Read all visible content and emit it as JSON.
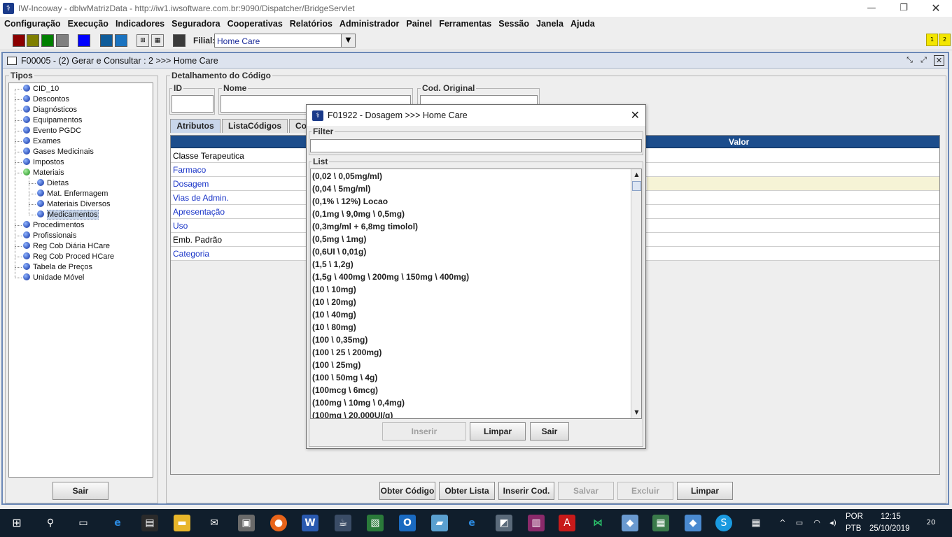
{
  "window": {
    "title": "IW-Incoway - dblwMatrizData - http://iw1.iwsoftware.com.br:9090/Dispatcher/BridgeServlet"
  },
  "menu": [
    "Configuração",
    "Execução",
    "Indicadores",
    "Seguradora",
    "Cooperativas",
    "Relatórios",
    "Administrador",
    "Painel",
    "Ferramentas",
    "Sessão",
    "Janela",
    "Ajuda"
  ],
  "toolbar": {
    "filial_label": "Filial:",
    "filial_value": "Home Care",
    "badges": [
      "1",
      "2"
    ],
    "swatch_colors": [
      "#8b0000",
      "#7f7f00",
      "#007f00",
      "#7f7f7f",
      "#0000ff",
      "#0f5c9a",
      "#1a73c0",
      "#3a3a3a"
    ]
  },
  "frame": {
    "title": "F00005 - (2) Gerar e Consultar : 2 >>> Home Care"
  },
  "tipos": {
    "label": "Tipos",
    "items": [
      {
        "label": "CID_10",
        "level": 0
      },
      {
        "label": "Descontos",
        "level": 0
      },
      {
        "label": "Diagnósticos",
        "level": 0
      },
      {
        "label": "Equipamentos",
        "level": 0
      },
      {
        "label": "Evento PGDC",
        "level": 0
      },
      {
        "label": "Exames",
        "level": 0
      },
      {
        "label": "Gases Medicinais",
        "level": 0
      },
      {
        "label": "Impostos",
        "level": 0
      },
      {
        "label": "Materiais",
        "level": 0,
        "expanded": true
      },
      {
        "label": "Dietas",
        "level": 1
      },
      {
        "label": "Mat. Enfermagem",
        "level": 1
      },
      {
        "label": "Materiais Diversos",
        "level": 1
      },
      {
        "label": "Medicamentos",
        "level": 1,
        "selected": true
      },
      {
        "label": "Procedimentos",
        "level": 0
      },
      {
        "label": "Profissionais",
        "level": 0
      },
      {
        "label": "Reg Cob Diária HCare",
        "level": 0
      },
      {
        "label": "Reg Cob Proced HCare",
        "level": 0
      },
      {
        "label": "Tabela de Preços",
        "level": 0
      },
      {
        "label": "Unidade Móvel",
        "level": 0
      }
    ],
    "sair": "Sair"
  },
  "detalhamento": {
    "label": "Detalhamento do Código",
    "id_label": "ID",
    "nome_label": "Nome",
    "cod_original_label": "Cod. Original",
    "tabs": [
      "Atributos",
      "ListaCódigos",
      "Co"
    ],
    "grid_header_valor": "Valor",
    "rows": [
      {
        "label": "Classe Terapeutica",
        "blue": false
      },
      {
        "label": "Farmaco",
        "blue": true
      },
      {
        "label": "Dosagem",
        "blue": true,
        "highlight": true
      },
      {
        "label": "Vias de Admin.",
        "blue": true
      },
      {
        "label": "Apresentação",
        "blue": true
      },
      {
        "label": "Uso",
        "blue": true
      },
      {
        "label": "Emb. Padrão",
        "blue": false
      },
      {
        "label": "Categoria",
        "blue": true
      }
    ]
  },
  "actions": [
    "Obter Código",
    "Obter Lista",
    "Inserir Cod.",
    "Salvar",
    "Excluir",
    "Limpar"
  ],
  "dialog": {
    "title": "F01922 - Dosagem >>> Home Care",
    "filter_label": "Filter",
    "list_label": "List",
    "items": [
      "(0,02 \\ 0,05mg/ml)",
      "(0,04 \\ 5mg/ml)",
      "(0,1% \\ 12%) Locao",
      "(0,1mg \\ 9,0mg \\ 0,5mg)",
      "(0,3mg/ml + 6,8mg timolol)",
      "(0,5mg \\ 1mg)",
      "(0,6UI \\ 0,01g)",
      "(1,5 \\ 1,2g)",
      "(1,5g \\ 400mg \\ 200mg \\ 150mg \\ 400mg)",
      "(10 \\ 10mg)",
      "(10 \\ 20mg)",
      "(10 \\ 40mg)",
      "(10 \\ 80mg)",
      "(100 \\ 0,35mg)",
      "(100 \\ 25 \\ 200mg)",
      "(100 \\ 25mg)",
      "(100 \\ 50mg \\ 4g)",
      "(100mcg \\ 6mcg)",
      "(100mg \\ 10mg \\ 0,4mg)",
      "(100mg \\ 20.000UI/g)"
    ],
    "buttons": {
      "inserir": "Inserir",
      "limpar": "Limpar",
      "sair": "Sair"
    }
  },
  "taskbar": {
    "lang1": "POR",
    "lang2": "PTB",
    "time": "12:15",
    "date": "25/10/2019",
    "notif": "20"
  }
}
